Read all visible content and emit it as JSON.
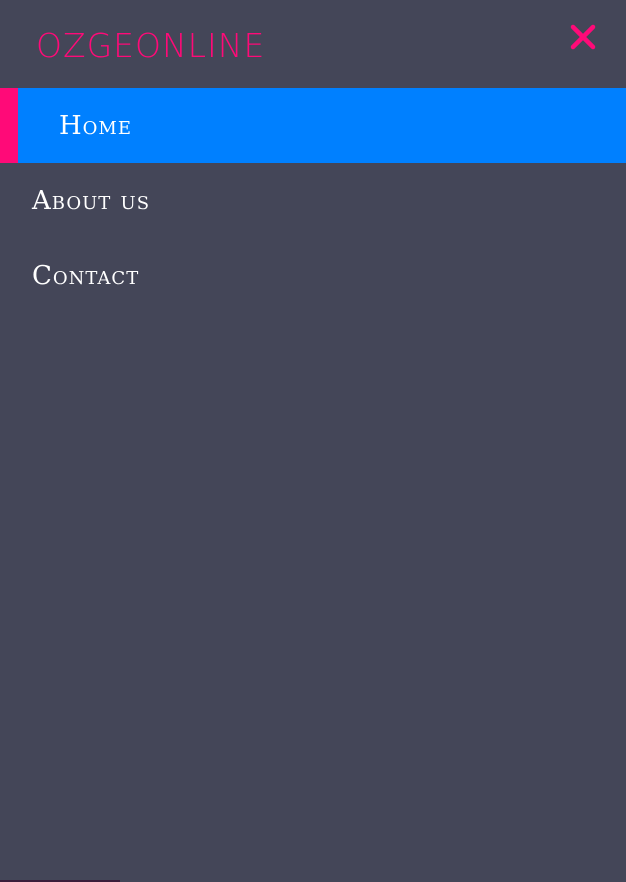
{
  "brand": {
    "logo_text": "OZGEONLINE",
    "color": "#ff0a78"
  },
  "close": {
    "icon": "close-icon",
    "color": "#ff0a78"
  },
  "nav": {
    "items": [
      {
        "label": "Home",
        "active": true
      },
      {
        "label": "About us",
        "active": false
      },
      {
        "label": "Contact",
        "active": false
      }
    ]
  },
  "colors": {
    "background": "#444658",
    "active_bg": "#0080ff",
    "accent": "#ff0a78",
    "text": "#ffffff"
  }
}
